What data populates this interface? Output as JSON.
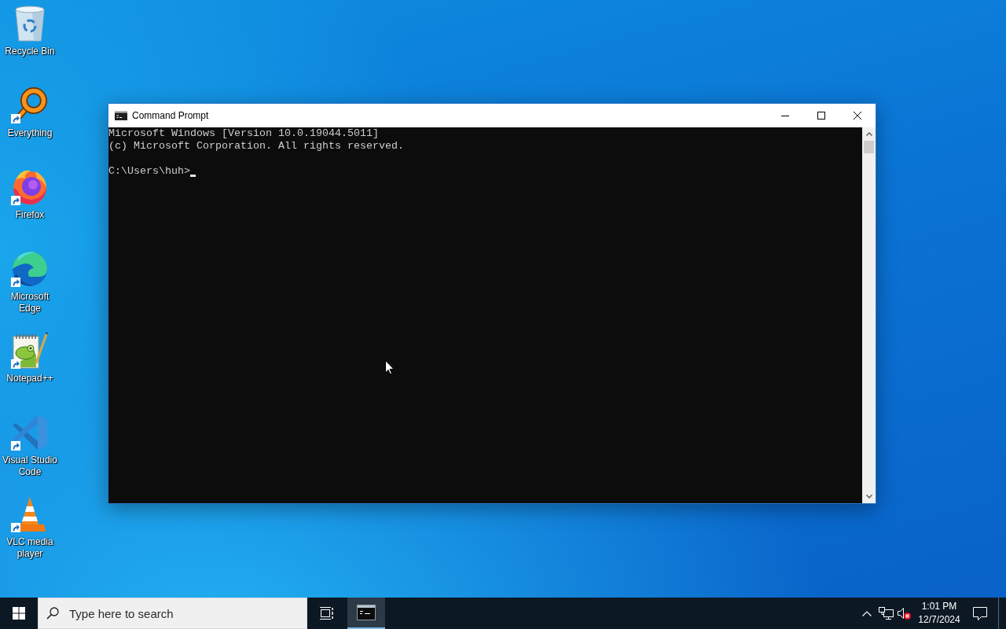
{
  "desktop": {
    "icons": [
      {
        "label": "Recycle Bin",
        "kind": "recycle-bin",
        "shortcut": false
      },
      {
        "label": "Everything",
        "kind": "magnifier",
        "shortcut": true
      },
      {
        "label": "Firefox",
        "kind": "flame-globe",
        "shortcut": true
      },
      {
        "label": "Microsoft Edge",
        "kind": "swirl",
        "shortcut": true
      },
      {
        "label": "Notepad++",
        "kind": "notepad",
        "shortcut": true
      },
      {
        "label": "Visual Studio Code",
        "kind": "ribbon",
        "shortcut": true
      },
      {
        "label": "VLC media player",
        "kind": "cone",
        "shortcut": true
      }
    ]
  },
  "window": {
    "title": "Command Prompt",
    "console": {
      "output": [
        "Microsoft Windows [Version 10.0.19044.5011]",
        "(c) Microsoft Corporation. All rights reserved."
      ],
      "prompt": "C:\\Users\\huh>"
    }
  },
  "taskbar": {
    "search": {
      "placeholder": "Type here to search"
    },
    "apps": [
      {
        "kind": "console",
        "selected": true
      }
    ],
    "tray": {
      "muted": true
    },
    "clock": {
      "time": "1:01 PM",
      "date": "12/7/2024"
    }
  }
}
